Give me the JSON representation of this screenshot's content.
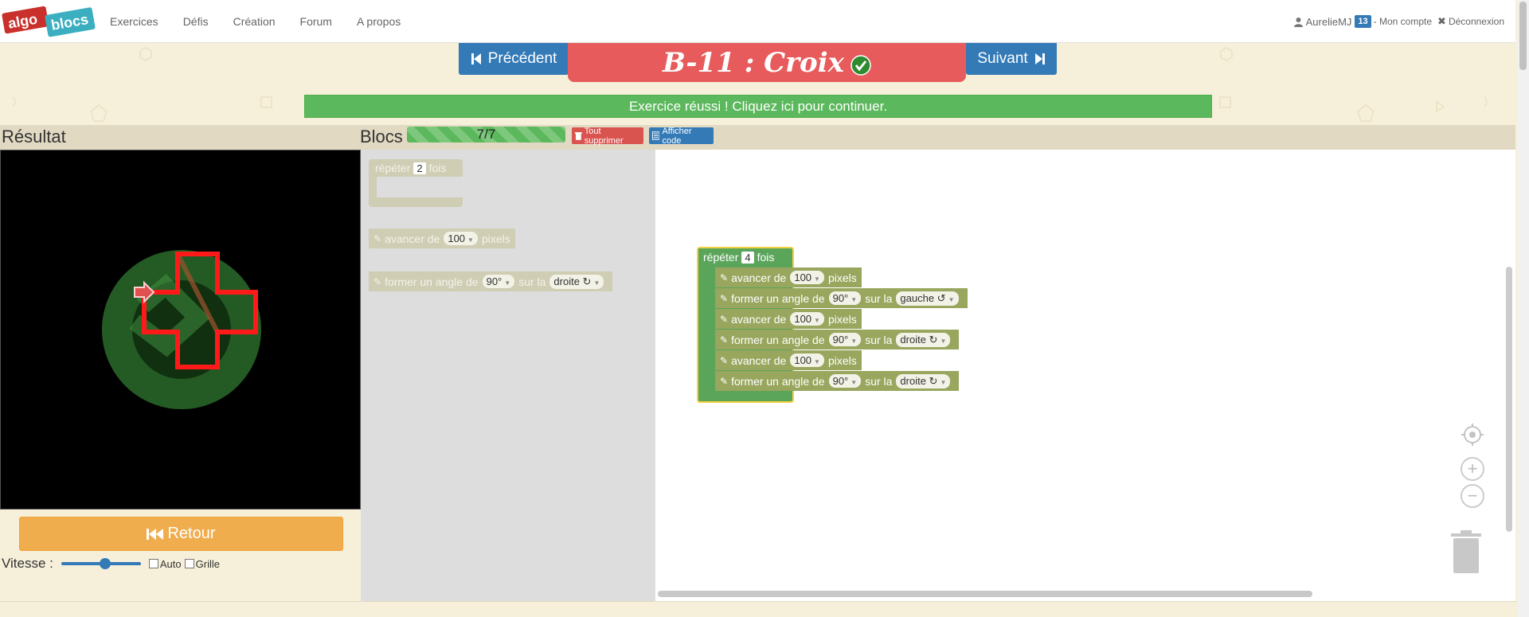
{
  "nav": {
    "logo_left": "algo",
    "logo_right": "blocs",
    "links": [
      "Exercices",
      "Défis",
      "Création",
      "Forum",
      "A propos"
    ],
    "user": "AurelieMJ",
    "badge": "13",
    "account": "- Mon compte",
    "logout": "Déconnexion"
  },
  "exercise": {
    "prev_label": "Précédent",
    "next_label": "Suivant",
    "title": "B-11 : Croix",
    "success_message": "Exercice réussi ! Cliquez ici pour continuer."
  },
  "panels": {
    "result_title": "Résultat",
    "blocks_title": "Blocs",
    "progress_text": "7/7",
    "progress_fraction": 1.0,
    "delete_all": "Tout supprimer",
    "show_code": "Afficher code"
  },
  "controls": {
    "back_label": "Retour",
    "speed_label": "Vitesse :",
    "speed_fraction": 0.55,
    "auto_label": "Auto",
    "grid_label": "Grille"
  },
  "toolbox": {
    "repeat": {
      "prefix": "répéter",
      "count": "2",
      "suffix": "fois"
    },
    "forward": {
      "prefix": "avancer de",
      "value": "100",
      "suffix": "pixels"
    },
    "turn": {
      "prefix": "former un angle de",
      "angle": "90°",
      "middle": "sur la",
      "direction": "droite ↻"
    }
  },
  "program": {
    "repeat": {
      "prefix": "répéter",
      "count": "4",
      "suffix": "fois"
    },
    "steps": [
      {
        "type": "forward",
        "prefix": "avancer de",
        "value": "100",
        "suffix": "pixels"
      },
      {
        "type": "turn",
        "prefix": "former un angle de",
        "angle": "90°",
        "middle": "sur la",
        "direction": "gauche ↺"
      },
      {
        "type": "forward",
        "prefix": "avancer de",
        "value": "100",
        "suffix": "pixels"
      },
      {
        "type": "turn",
        "prefix": "former un angle de",
        "angle": "90°",
        "middle": "sur la",
        "direction": "droite ↻"
      },
      {
        "type": "forward",
        "prefix": "avancer de",
        "value": "100",
        "suffix": "pixels"
      },
      {
        "type": "turn",
        "prefix": "former un angle de",
        "angle": "90°",
        "middle": "sur la",
        "direction": "droite ↻"
      }
    ]
  },
  "colors": {
    "primary": "#337ab7",
    "title_bg": "#e85b5c",
    "success": "#5cb85c",
    "warning": "#f0ad4e",
    "danger": "#d9534f",
    "loop_block": "#5ba55b",
    "action_block": "#98a65e"
  }
}
